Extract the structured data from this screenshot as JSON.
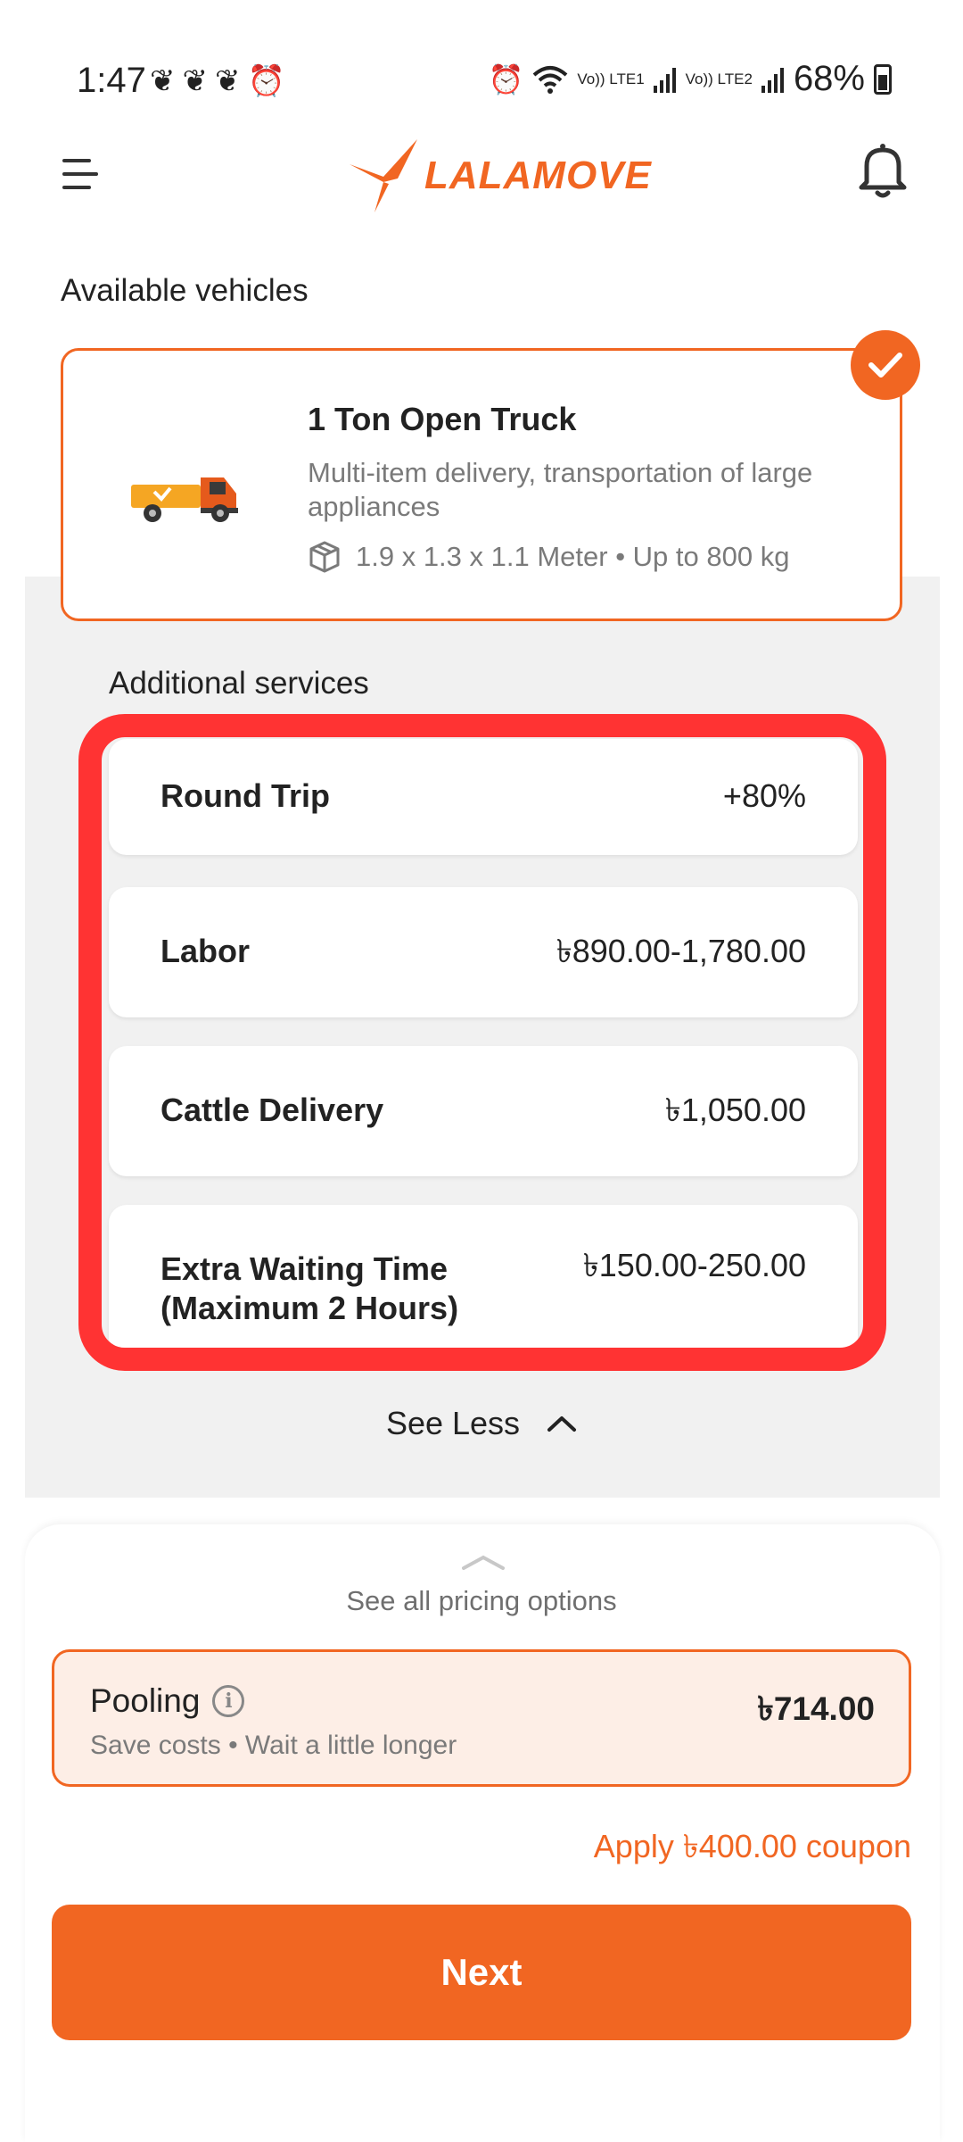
{
  "status_bar": {
    "time": "1:47",
    "battery": "68%",
    "lte1": "Vo)) LTE1",
    "lte2": "Vo)) LTE2"
  },
  "header": {
    "logo_text": "LALAMOVE",
    "brand_color": "#f16622"
  },
  "vehicles": {
    "section_title": "Available vehicles",
    "selected": {
      "name": "1 Ton Open Truck",
      "description": "Multi-item delivery, transportation of large appliances",
      "dimensions": "1.9 x 1.3 x 1.1 Meter • Up to 800 kg"
    }
  },
  "additional_services": {
    "title": "Additional services",
    "items": [
      {
        "label": "Round Trip",
        "price": "+80%"
      },
      {
        "label": "Labor",
        "price": "৳890.00-1,780.00"
      },
      {
        "label": "Cattle Delivery",
        "price": "৳1,050.00"
      },
      {
        "label": "Extra Waiting Time (Maximum 2 Hours)",
        "price": "৳150.00-250.00"
      }
    ],
    "see_less": "See Less"
  },
  "pricing": {
    "see_all": "See all pricing options",
    "option": {
      "title": "Pooling",
      "subtitle": "Save costs • Wait a little longer",
      "price": "৳714.00"
    },
    "coupon": "Apply ৳400.00 coupon"
  },
  "actions": {
    "next": "Next"
  }
}
